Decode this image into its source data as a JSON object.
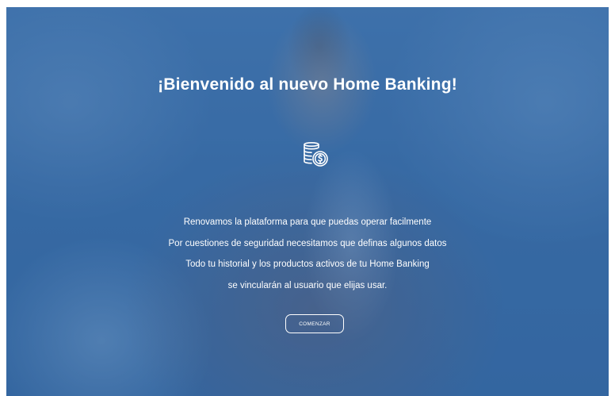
{
  "page": {
    "title": "¡Bienvenido al nuevo Home Banking!",
    "icon": "coins-dollar-icon",
    "lines": [
      "Renovamos la plataforma para que puedas operar facilmente",
      "Por cuestiones de seguridad necesitamos que definas algunos datos",
      "Todo tu historial y los productos activos de tu Home Banking",
      "se vincularán al usuario que elijas usar."
    ],
    "button_label": "COMENZAR"
  },
  "colors": {
    "overlay": "#3d6ea3",
    "text": "#ffffff"
  }
}
